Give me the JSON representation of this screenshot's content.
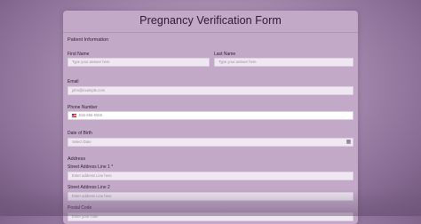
{
  "form": {
    "title": "Pregnancy Verification Form",
    "patient_section": "Patient Information",
    "first_name_label": "First Name",
    "first_name_placeholder": "Type your answer here",
    "last_name_label": "Last Name",
    "last_name_placeholder": "Type your answer here",
    "email_label": "Email",
    "email_placeholder": "john@example.com",
    "phone_label": "Phone Number",
    "phone_placeholder": "555-555-5555",
    "dob_label": "Date of Birth",
    "dob_placeholder": "Select Date",
    "address_section": "Address",
    "street1_label": "Street Address Line 1 *",
    "street1_placeholder": "Enter address Line here",
    "street2_label": "Street Address Line 2",
    "street2_placeholder": "Enter address Line here",
    "postal_label": "Postal Code",
    "postal_placeholder": "Enter your code"
  },
  "icons": {
    "phone_flag": "us-flag-icon",
    "dob_calendar": "calendar-icon"
  },
  "colors": {
    "background": "#a58aae",
    "card": "#c2a9c8",
    "input": "#efe7f1"
  }
}
